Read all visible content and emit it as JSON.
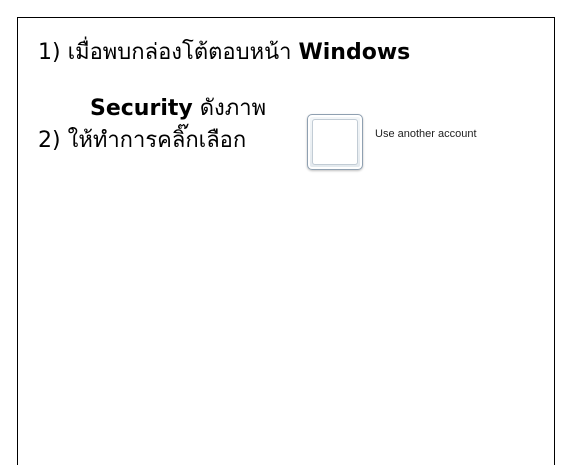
{
  "steps": {
    "step1_prefix": "1) เมื่อพบกล่องโต้ตอบหน้า ",
    "step1_bold_1": "Windows",
    "step1_bold_2": "Security",
    "step1_suffix": " ดังภาพ",
    "step2_text": "2) ให้ทำการคลิ๊กเลือก"
  },
  "dialog": {
    "account_option_label": "Use another account"
  }
}
